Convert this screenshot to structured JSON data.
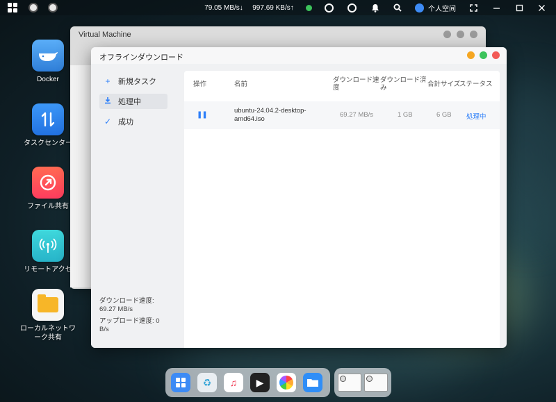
{
  "topbar": {
    "download_speed": "79.05 MB/s",
    "upload_speed": "997.69 KB/s",
    "user_label": "个人空间"
  },
  "desktop": {
    "icons": [
      {
        "label": "Docker"
      },
      {
        "label": "タスクセンター"
      },
      {
        "label": "ファイル共有"
      },
      {
        "label": "リモートアクセ"
      },
      {
        "label": "ローカルネットワーク共有"
      }
    ]
  },
  "background_window": {
    "title": "Virtual Machine"
  },
  "download_window": {
    "title": "オフラインダウンロード",
    "sidebar": {
      "items": [
        {
          "label": "新規タスク",
          "icon": "plus-icon"
        },
        {
          "label": "処理中",
          "icon": "download-icon"
        },
        {
          "label": "成功",
          "icon": "check-icon"
        }
      ],
      "download_speed": "ダウンロード速度: 69.27 MB/s",
      "upload_speed": "アップロード速度: 0 B/s"
    },
    "table": {
      "headers": {
        "operation": "操作",
        "name": "名前",
        "speed": "ダウンロード速度",
        "downloaded": "ダウンロード済み",
        "total_size": "合計サイズ",
        "status": "ステータス"
      },
      "rows": [
        {
          "name": "ubuntu-24.04.2-desktop-amd64.iso",
          "speed": "69.27 MB/s",
          "downloaded": "1 GB",
          "total_size": "6 GB",
          "status": "処理中"
        }
      ]
    }
  },
  "colors": {
    "accent": "#2d7ff9",
    "btn_min": "#f5a623",
    "btn_max": "#3cc35b",
    "btn_close": "#f25a56"
  }
}
